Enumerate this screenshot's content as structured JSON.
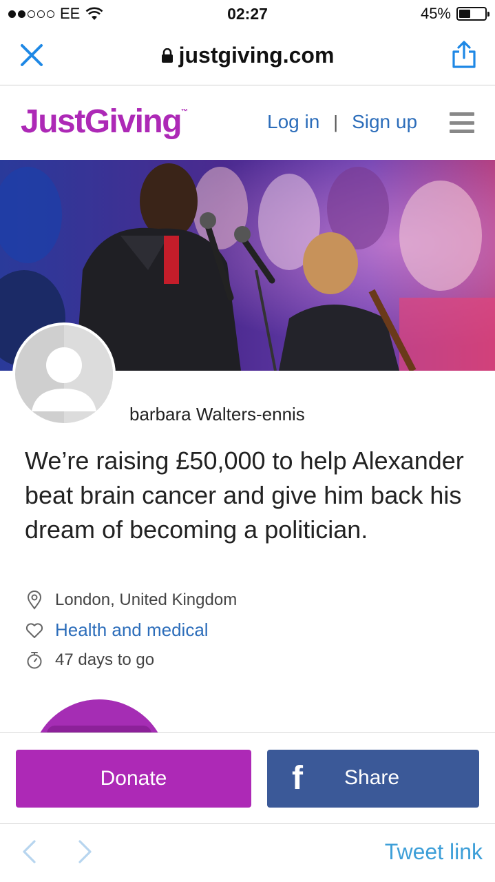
{
  "status_bar": {
    "carrier": "EE",
    "time": "02:27",
    "battery_percent_label": "45%",
    "battery_level": 0.45
  },
  "browser": {
    "url": "justgiving.com"
  },
  "site_header": {
    "logo": "JustGiving",
    "logo_tm": "™",
    "login": "Log in",
    "separator": "|",
    "signup": "Sign up"
  },
  "profile": {
    "owner_name": "barbara Walters-ennis"
  },
  "campaign": {
    "headline": "We’re raising £50,000 to help Alexander beat brain cancer and give him back his dream of becoming a politician.",
    "location": "London, United Kingdom",
    "category": "Health and medical",
    "time_left": "47 days to go"
  },
  "actions": {
    "donate_label": "Donate",
    "share_icon": "f",
    "share_label": "Share"
  },
  "toolbar": {
    "tweet_link": "Tweet link"
  },
  "colors": {
    "brand_purple": "#ad29b6",
    "link_blue": "#2c6dba",
    "facebook_blue": "#3b5998",
    "ios_blue": "#3e9fd8"
  },
  "icons": [
    "signal-dots-icon",
    "wifi-icon",
    "battery-icon",
    "close-icon",
    "lock-icon",
    "share-icon",
    "hamburger-menu-icon",
    "avatar-placeholder-icon",
    "location-pin-icon",
    "heart-icon",
    "stopwatch-icon",
    "facebook-icon",
    "chevron-left-icon",
    "chevron-right-icon"
  ]
}
